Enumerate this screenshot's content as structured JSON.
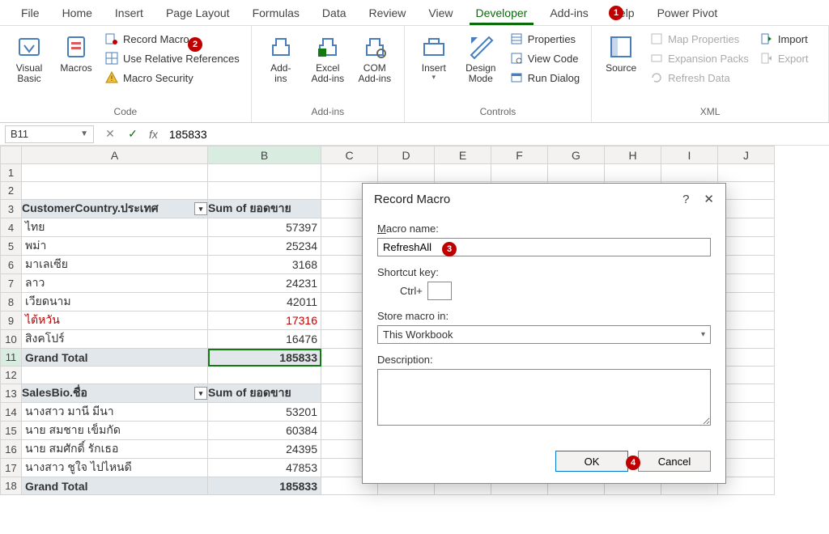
{
  "tabs": [
    "File",
    "Home",
    "Insert",
    "Page Layout",
    "Formulas",
    "Data",
    "Review",
    "View",
    "Developer",
    "Add-ins",
    "Help",
    "Power Pivot"
  ],
  "active_tab_index": 8,
  "ribbon": {
    "code": {
      "visual_basic": "Visual\nBasic",
      "macros": "Macros",
      "record_macro": "Record Macro",
      "use_relative": "Use Relative References",
      "macro_security": "Macro Security",
      "label": "Code"
    },
    "addins": {
      "addins": "Add-\nins",
      "excel_addins": "Excel\nAdd-ins",
      "com_addins": "COM\nAdd-ins",
      "label": "Add-ins"
    },
    "controls": {
      "insert": "Insert",
      "design_mode": "Design\nMode",
      "properties": "Properties",
      "view_code": "View Code",
      "run_dialog": "Run Dialog",
      "label": "Controls"
    },
    "xml": {
      "source": "Source",
      "map_properties": "Map Properties",
      "expansion_packs": "Expansion Packs",
      "refresh_data": "Refresh Data",
      "import": "Import",
      "export": "Export",
      "label": "XML"
    }
  },
  "formula_bar": {
    "name_box": "B11",
    "formula": "185833"
  },
  "columns": [
    "",
    "A",
    "B",
    "C",
    "D",
    "E",
    "F",
    "G",
    "H",
    "I",
    "J"
  ],
  "rows": [
    {
      "n": 1,
      "a": "",
      "b": ""
    },
    {
      "n": 2,
      "a": "",
      "b": ""
    },
    {
      "n": 3,
      "a": "CustomerCountry.ประเทศ",
      "b": "Sum of ยอดขาย",
      "header": true
    },
    {
      "n": 4,
      "a": "ไทย",
      "b": "57397"
    },
    {
      "n": 5,
      "a": "พม่า",
      "b": "25234"
    },
    {
      "n": 6,
      "a": "มาเลเซีย",
      "b": "3168"
    },
    {
      "n": 7,
      "a": "ลาว",
      "b": "24231"
    },
    {
      "n": 8,
      "a": "เวียดนาม",
      "b": "42011"
    },
    {
      "n": 9,
      "a": "ไต้หวัน",
      "b": "17316",
      "red": true
    },
    {
      "n": 10,
      "a": "สิงคโปร์",
      "b": "16476"
    },
    {
      "n": 11,
      "a": "Grand Total",
      "b": "185833",
      "total": true,
      "active": true
    },
    {
      "n": 12,
      "a": "",
      "b": ""
    },
    {
      "n": 13,
      "a": "SalesBio.ชื่อ",
      "b": "Sum of ยอดขาย",
      "header": true
    },
    {
      "n": 14,
      "a": "นางสาว มานี มีนา",
      "b": "53201"
    },
    {
      "n": 15,
      "a": "นาย สมชาย เข็มกัด",
      "b": "60384"
    },
    {
      "n": 16,
      "a": "นาย สมศักดิ์ รักเธอ",
      "b": "24395"
    },
    {
      "n": 17,
      "a": "นางสาว ชูใจ ไปไหนดี",
      "b": "47853"
    },
    {
      "n": 18,
      "a": "Grand Total",
      "b": "185833",
      "total": true
    }
  ],
  "dialog": {
    "title": "Record Macro",
    "macro_name_label": "Macro name:",
    "macro_name_value": "RefreshAll",
    "shortcut_label": "Shortcut key:",
    "shortcut_prefix": "Ctrl+",
    "store_label": "Store macro in:",
    "store_value": "This Workbook",
    "description_label": "Description:",
    "ok": "OK",
    "cancel": "Cancel"
  },
  "badges": {
    "b1": "1",
    "b2": "2",
    "b3": "3",
    "b4": "4"
  }
}
